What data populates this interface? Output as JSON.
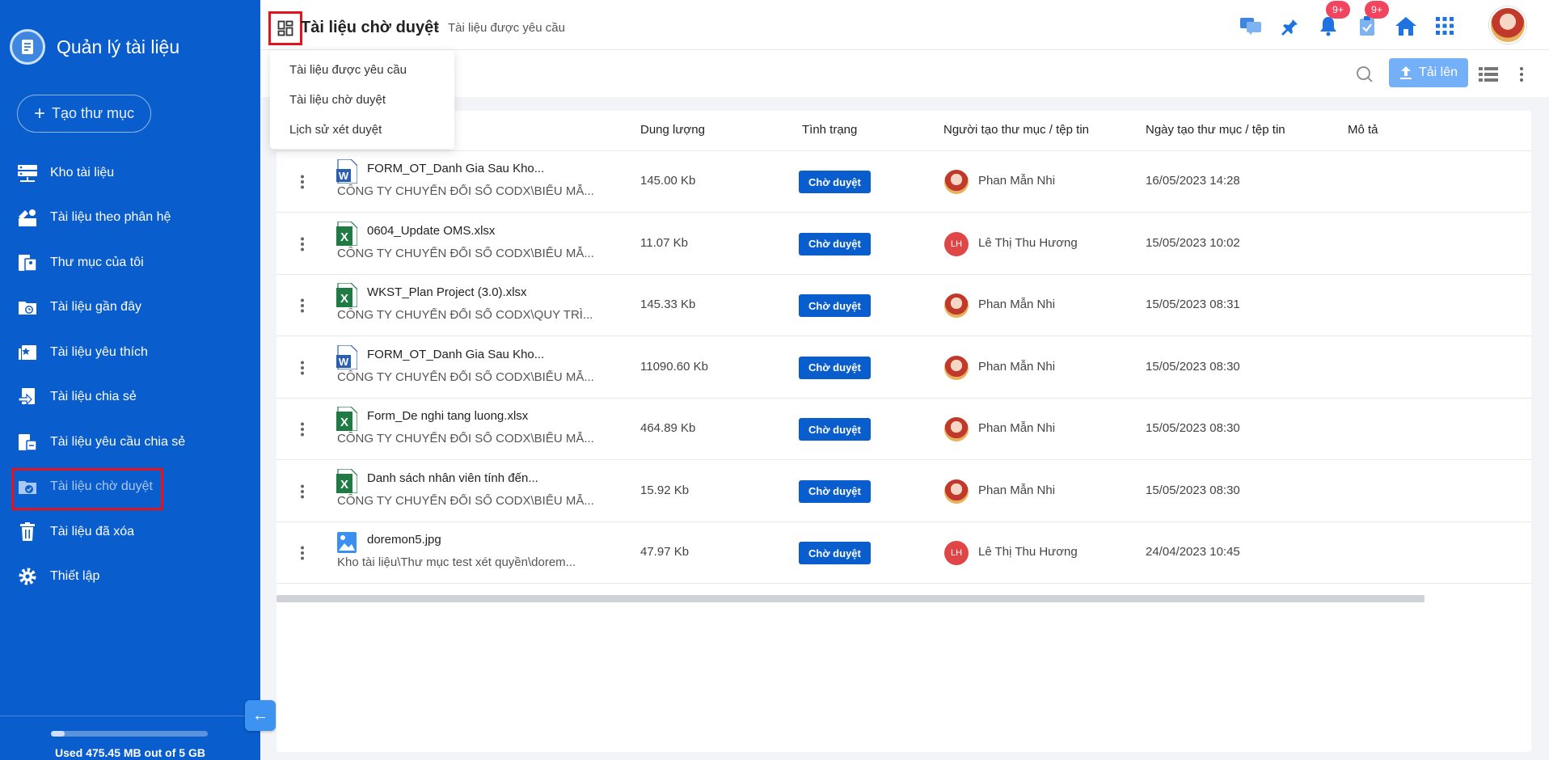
{
  "sidebar": {
    "title": "Quản lý tài liệu",
    "new_folder_label": "Tạo thư mục",
    "items": [
      {
        "label": "Kho tài liệu",
        "icon": "server-icon"
      },
      {
        "label": "Tài liệu theo phân hệ",
        "icon": "modules-icon"
      },
      {
        "label": "Thư mục của tôi",
        "icon": "my-folder-icon"
      },
      {
        "label": "Tài liệu gần đây",
        "icon": "recent-icon"
      },
      {
        "label": "Tài liệu yêu thích",
        "icon": "favorite-icon"
      },
      {
        "label": "Tài liệu chia sẻ",
        "icon": "share-icon"
      },
      {
        "label": "Tài liệu yêu cầu chia sẻ",
        "icon": "share-request-icon"
      },
      {
        "label": "Tài liệu chờ duyệt",
        "icon": "pending-icon",
        "active": true
      },
      {
        "label": "Tài liệu đã xóa",
        "icon": "trash-icon"
      },
      {
        "label": "Thiết lập",
        "icon": "gear-icon"
      }
    ],
    "storage_text": "Used 475.45 MB out of 5 GB",
    "storage_fraction": 0.09
  },
  "header": {
    "title": "Tài liệu chờ duyệt",
    "breadcrumb": "Tài liệu được yêu cầu",
    "notification_badge": "9+",
    "task_badge": "9+"
  },
  "toolbar": {
    "upload_label": "Tải lên"
  },
  "dropdown": {
    "items": [
      "Tài liệu được yêu cầu",
      "Tài liệu chờ duyệt",
      "Lịch sử xét duyệt"
    ]
  },
  "table": {
    "columns": {
      "size": "Dung lượng",
      "status": "Tình trạng",
      "creator": "Người tạo thư mục / tệp tin",
      "created": "Ngày tạo thư mục / tệp tin",
      "desc": "Mô tả"
    },
    "rows": [
      {
        "type": "word",
        "name": "FORM_OT_Danh Gia Sau Kho...",
        "path": "CÔNG TY CHUYỂN ĐỔI SỐ CODX\\BIỂU MẪ...",
        "size": "145.00 Kb",
        "status": "Chờ duyệt",
        "user": "Phan Mẫn Nhi",
        "avatar": "photo",
        "date": "16/05/2023 14:28"
      },
      {
        "type": "excel",
        "name": "0604_Update OMS.xlsx",
        "path": "CÔNG TY CHUYỂN ĐỔI SỐ CODX\\BIỂU MẪ...",
        "size": "11.07 Kb",
        "status": "Chờ duyệt",
        "user": "Lê Thị Thu Hương",
        "avatar": "initials",
        "initials": "LH",
        "date": "15/05/2023 10:02"
      },
      {
        "type": "excel",
        "name": "WKST_Plan Project (3.0).xlsx",
        "path": "CÔNG TY CHUYỂN ĐỔI SỐ CODX\\QUY TRÌ...",
        "size": "145.33 Kb",
        "status": "Chờ duyệt",
        "user": "Phan Mẫn Nhi",
        "avatar": "photo",
        "date": "15/05/2023 08:31"
      },
      {
        "type": "word",
        "name": "FORM_OT_Danh Gia Sau Kho...",
        "path": "CÔNG TY CHUYỂN ĐỔI SỐ CODX\\BIỂU MẪ...",
        "size": "11090.60 Kb",
        "status": "Chờ duyệt",
        "user": "Phan Mẫn Nhi",
        "avatar": "photo",
        "date": "15/05/2023 08:30"
      },
      {
        "type": "excel",
        "name": "Form_De nghi tang luong.xlsx",
        "path": "CÔNG TY CHUYỂN ĐỔI SỐ CODX\\BIỂU MẪ...",
        "size": "464.89 Kb",
        "status": "Chờ duyệt",
        "user": "Phan Mẫn Nhi",
        "avatar": "photo",
        "date": "15/05/2023 08:30"
      },
      {
        "type": "excel",
        "name": "Danh sách nhân viên tính đến...",
        "path": "CÔNG TY CHUYỂN ĐỔI SỐ CODX\\BIỂU MẪ...",
        "size": "15.92 Kb",
        "status": "Chờ duyệt",
        "user": "Phan Mẫn Nhi",
        "avatar": "photo",
        "date": "15/05/2023 08:30"
      },
      {
        "type": "image",
        "name": "doremon5.jpg",
        "path": "Kho tài liệu\\Thư mục test xét quyền\\dorem...",
        "size": "47.97 Kb",
        "status": "Chờ duyệt",
        "user": "Lê Thị Thu Hương",
        "avatar": "initials",
        "initials": "LH",
        "date": "24/04/2023 10:45"
      }
    ]
  },
  "colors": {
    "sidebar": "#0a5dcc",
    "status_badge": "#0a5dcc",
    "highlight": "#e3141b",
    "notification": "#f0445f"
  }
}
